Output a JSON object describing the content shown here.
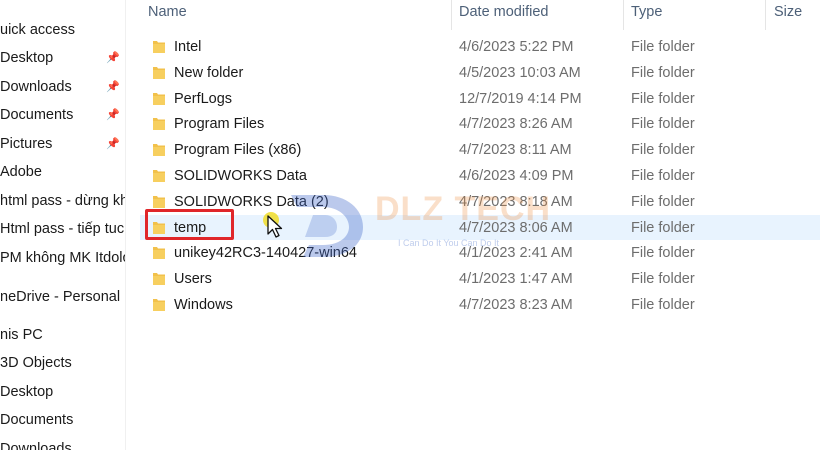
{
  "nav": {
    "items": [
      {
        "label": "uick access",
        "pinned": false
      },
      {
        "label": "Desktop",
        "pinned": true
      },
      {
        "label": "Downloads",
        "pinned": true
      },
      {
        "label": "Documents",
        "pinned": true
      },
      {
        "label": "Pictures",
        "pinned": true
      },
      {
        "label": "Adobe",
        "pinned": false
      },
      {
        "label": "html pass - dừng kh",
        "pinned": false
      },
      {
        "label": "Html pass - tiếp tuc",
        "pinned": false
      },
      {
        "label": "PM không MK Itdolo",
        "pinned": false
      },
      {
        "label": "neDrive - Personal",
        "pinned": false
      },
      {
        "label": "nis PC",
        "pinned": false
      },
      {
        "label": "3D Objects",
        "pinned": false
      },
      {
        "label": "Desktop",
        "pinned": false
      },
      {
        "label": "Documents",
        "pinned": false
      },
      {
        "label": "Downloads",
        "pinned": false
      }
    ]
  },
  "columns": {
    "name": "Name",
    "date": "Date modified",
    "type": "Type",
    "size": "Size"
  },
  "rows": [
    {
      "name": "Intel",
      "date": "4/6/2023 5:22 PM",
      "type": "File folder"
    },
    {
      "name": "New folder",
      "date": "4/5/2023 10:03 AM",
      "type": "File folder"
    },
    {
      "name": "PerfLogs",
      "date": "12/7/2019 4:14 PM",
      "type": "File folder"
    },
    {
      "name": "Program Files",
      "date": "4/7/2023 8:26 AM",
      "type": "File folder"
    },
    {
      "name": "Program Files (x86)",
      "date": "4/7/2023 8:11 AM",
      "type": "File folder"
    },
    {
      "name": "SOLIDWORKS Data",
      "date": "4/6/2023 4:09 PM",
      "type": "File folder"
    },
    {
      "name": "SOLIDWORKS Data (2)",
      "date": "4/7/2023 8:18 AM",
      "type": "File folder"
    },
    {
      "name": "temp",
      "date": "4/7/2023 8:06 AM",
      "type": "File folder"
    },
    {
      "name": "unikey42RC3-140427-win64",
      "date": "4/1/2023 2:41 AM",
      "type": "File folder"
    },
    {
      "name": "Users",
      "date": "4/1/2023 1:47 AM",
      "type": "File folder"
    },
    {
      "name": "Windows",
      "date": "4/7/2023 8:23 AM",
      "type": "File folder"
    }
  ],
  "watermark": {
    "title": "DLZ TECH",
    "subtitle": "I Can Do It You Can Do It"
  },
  "colors": {
    "folder": "#f2c14b",
    "hover_row": "#e8f3fe",
    "highlight_box": "#e0262a"
  }
}
